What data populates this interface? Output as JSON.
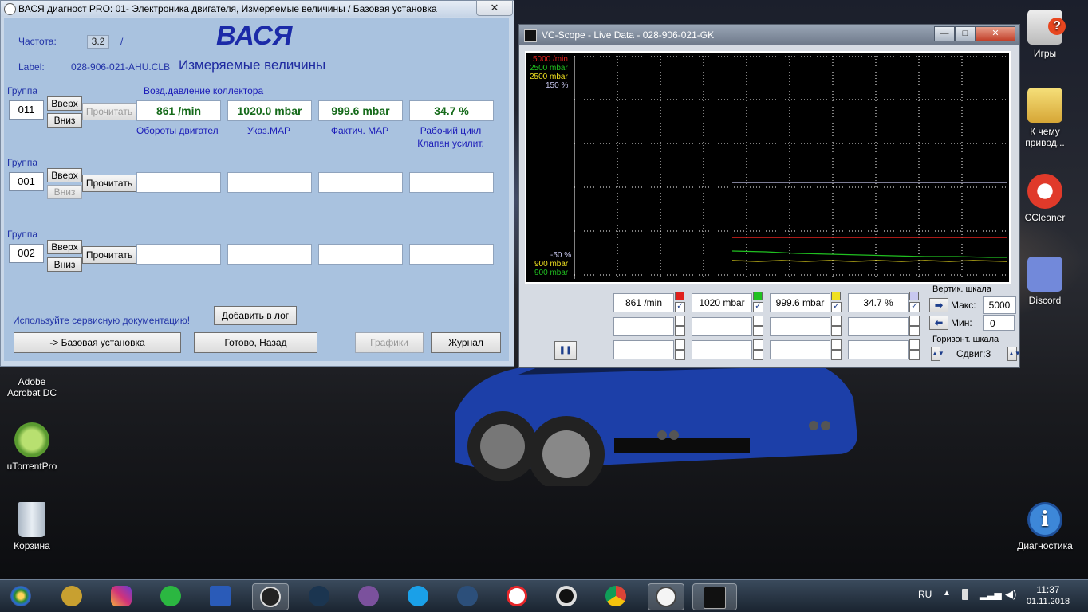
{
  "win1": {
    "title": "ВАСЯ диагност PRO: 01- Электроника двигателя,  Измеряемые величины / Базовая установка",
    "close": "✕",
    "freq_label": "Частота:",
    "freq_value": "3.2",
    "freq_slash": "/",
    "logo": "ВАСЯ",
    "label_label": "Label:",
    "label_value": "028-906-021-AHU.CLB",
    "section_title": "Измеряемые величины",
    "groups": [
      {
        "label": "Группа",
        "number": "011",
        "up": "Вверх",
        "down": "Вниз",
        "read": "Прочитать",
        "header": "Возд.давление коллектора",
        "values": [
          "861 /min",
          "1020.0 mbar",
          "999.6 mbar",
          "34.7 %"
        ],
        "captions": [
          "Обороты двигателя",
          "Указ.MAP",
          "Фактич. MAP",
          "Рабочий цикл"
        ],
        "caption2": "Клапан усилит."
      },
      {
        "label": "Группа",
        "number": "001",
        "up": "Вверх",
        "down": "Вниз",
        "read": "Прочитать"
      },
      {
        "label": "Группа",
        "number": "002",
        "up": "Вверх",
        "down": "Вниз",
        "read": "Прочитать"
      }
    ],
    "service_doc": "Используйте сервисную документацию!",
    "add_log": "Добавить в лог",
    "basic_setting": "-> Базовая установка",
    "done_back": "Готово, Назад",
    "graphs": "Графики",
    "journal": "Журнал"
  },
  "win2": {
    "title": "VC-Scope  -  Live Data  -  028-906-021-GK",
    "min_btn": "—",
    "max_btn": "□",
    "close_btn": "✕",
    "y_labels_top": [
      "5000 /min",
      "2500 mbar",
      "2500 mbar",
      "150 %"
    ],
    "y_labels_bottom": [
      "-50 %",
      "900 mbar",
      "900 mbar"
    ],
    "channels": [
      {
        "value": "861 /min",
        "color": "#e0201c",
        "checked": true
      },
      {
        "value": "1020 mbar",
        "color": "#20c020",
        "checked": true
      },
      {
        "value": "999.6 mbar",
        "color": "#f0e020",
        "checked": true
      },
      {
        "value": "34.7 %",
        "color": "#c8c8f0",
        "checked": true
      }
    ],
    "vert_scale": "Вертик. шкала",
    "max_label": "Макс:",
    "max_value": "5000",
    "min_label": "Мин:",
    "min_value": "0",
    "horiz_scale": "Горизонт. шкала",
    "shift": "Сдвиг:3",
    "pause": "❚❚"
  },
  "desktop_icons": {
    "games": "Игры",
    "folder": "К чему привод...",
    "ccleaner": "CCleaner",
    "discord": "Discord",
    "diagnostics": "Диагностика",
    "acrobat": "Adobe Acrobat DC",
    "utorrent": "uTorrentPro",
    "recycle": "Корзина"
  },
  "tray": {
    "lang": "RU",
    "time": "11:37",
    "date": "01.11.2018"
  }
}
